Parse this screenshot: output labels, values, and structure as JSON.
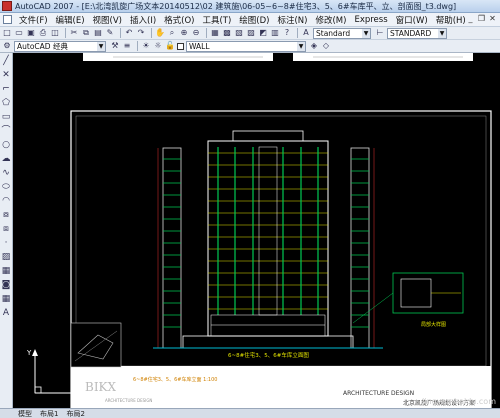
{
  "window": {
    "title": "AutoCAD 2007 - [E:\\北湾凯旋广场文本20140512\\02 建筑施\\06-05~6~8#住宅3、5、6#车库平、立、剖面图_t3.dwg]"
  },
  "menu": {
    "items": [
      "文件(F)",
      "编辑(E)",
      "视图(V)",
      "插入(I)",
      "格式(O)",
      "工具(T)",
      "绘图(D)",
      "标注(N)",
      "修改(M)",
      "Express",
      "窗口(W)",
      "帮助(H)"
    ]
  },
  "toolbar": {
    "text_style": "Standard",
    "dim_style": "STANDARD",
    "workspace": "AutoCAD 经典",
    "layer": "WALL"
  },
  "drawing": {
    "sheet_caption": "6~8#住宅3、5、6#车库立面图",
    "north_label": "BIKX",
    "design_label": "ARCHITECTURE DESIGN",
    "company_label": "北京凯旋广场规划设计方案",
    "detail_label": "局部大样图",
    "left_small": "ARCHITECTURE DESIGN",
    "scale_note": "6~8#住宅3、5、6#车库立面  1:100"
  },
  "ucs": {
    "x": "X",
    "y": "Y"
  },
  "status": {
    "tabs": [
      "模型",
      "布局1",
      "布局2"
    ]
  },
  "watermark": "jingyan.baidu.com",
  "colors": {
    "facade": "#ffffff",
    "accent_green": "#00c853",
    "accent_yellow": "#e6e600",
    "accent_red": "#e83030",
    "accent_cyan": "#00bcd4"
  }
}
